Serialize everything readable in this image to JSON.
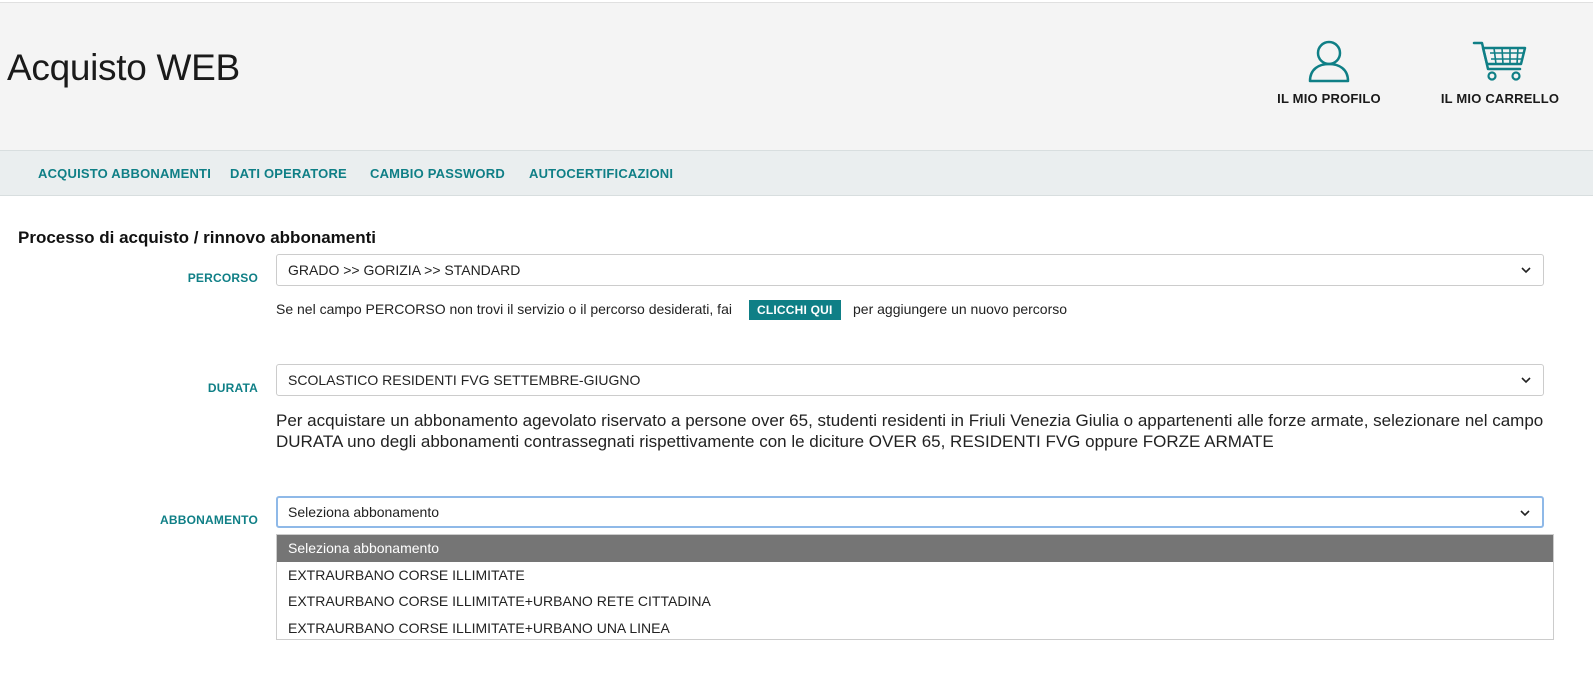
{
  "header": {
    "title": "Acquisto WEB",
    "profile_label": "IL MIO PROFILO",
    "cart_label": "IL MIO CARRELLO"
  },
  "nav": {
    "items": [
      {
        "label": "ACQUISTO ABBONAMENTI"
      },
      {
        "label": "DATI OPERATORE"
      },
      {
        "label": "CAMBIO PASSWORD"
      },
      {
        "label": "AUTOCERTIFICAZIONI"
      }
    ]
  },
  "main": {
    "section_title": "Processo di acquisto / rinnovo abbonamenti",
    "percorso": {
      "label": "PERCORSO",
      "value": "GRADO >> GORIZIA >> STANDARD",
      "hint_before": "Se nel campo PERCORSO non trovi il servizio o il percorso desiderati, fai",
      "button_label": "CLICCHI QUI",
      "hint_after": "per aggiungere un nuovo percorso"
    },
    "durata": {
      "label": "DURATA",
      "value": "SCOLASTICO RESIDENTI FVG SETTEMBRE-GIUGNO",
      "info": "Per acquistare un abbonamento agevolato riservato a persone over 65, studenti residenti in Friuli Venezia Giulia o appartenenti alle forze armate, selezionare nel campo DURATA uno degli abbonamenti contrassegnati rispettivamente con le diciture OVER 65, RESIDENTI FVG oppure FORZE ARMATE"
    },
    "abbonamento": {
      "label": "ABBONAMENTO",
      "value": "Seleziona abbonamento",
      "options": [
        "Seleziona abbonamento",
        "EXTRAURBANO CORSE ILLIMITATE",
        "EXTRAURBANO CORSE ILLIMITATE+URBANO RETE CITTADINA",
        "EXTRAURBANO CORSE ILLIMITATE+URBANO UNA LINEA"
      ]
    }
  },
  "colors": {
    "accent": "#0f7f86",
    "header_bg": "#f4f4f4",
    "nav_bg": "#eaeeef",
    "selected_option_bg": "#757575"
  },
  "icons": {
    "profile": "user-icon",
    "cart": "cart-icon",
    "select": "chevron-down-icon"
  }
}
